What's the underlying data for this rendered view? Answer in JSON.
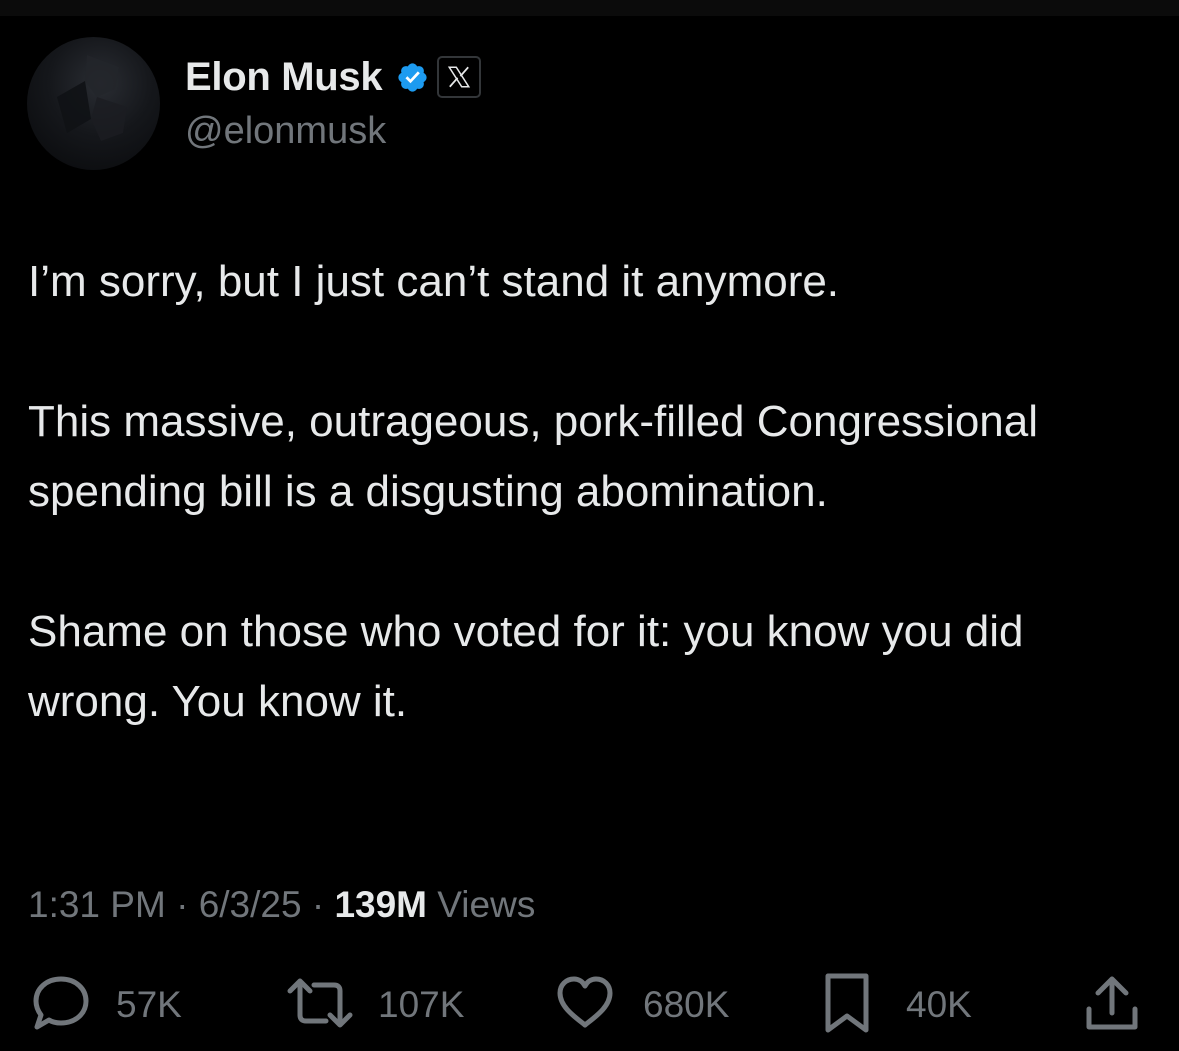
{
  "author": {
    "display_name": "Elon Musk",
    "handle": "@elonmusk",
    "verified": true,
    "badge_color": "#1d9bf0",
    "affiliation_icon": "x-logo-icon"
  },
  "tweet": {
    "paragraphs": [
      "I’m sorry, but I just can’t stand it anymore.",
      "This massive, outrageous, pork-filled Congressional spending bill is a disgusting abomination.",
      "Shame on those who voted for it: you know you did wrong. You know it."
    ],
    "time": "1:31 PM",
    "date": "6/3/25",
    "separator": " · ",
    "views_count": "139M",
    "views_label": " Views"
  },
  "actions": {
    "reply_count": "57K",
    "repost_count": "107K",
    "like_count": "680K",
    "bookmark_count": "40K",
    "icons": [
      "reply-icon",
      "repost-icon",
      "like-icon",
      "bookmark-icon",
      "share-icon"
    ]
  },
  "colors": {
    "background": "#000000",
    "text": "#e7e9ea",
    "secondary": "#71767b",
    "accent": "#1d9bf0"
  }
}
